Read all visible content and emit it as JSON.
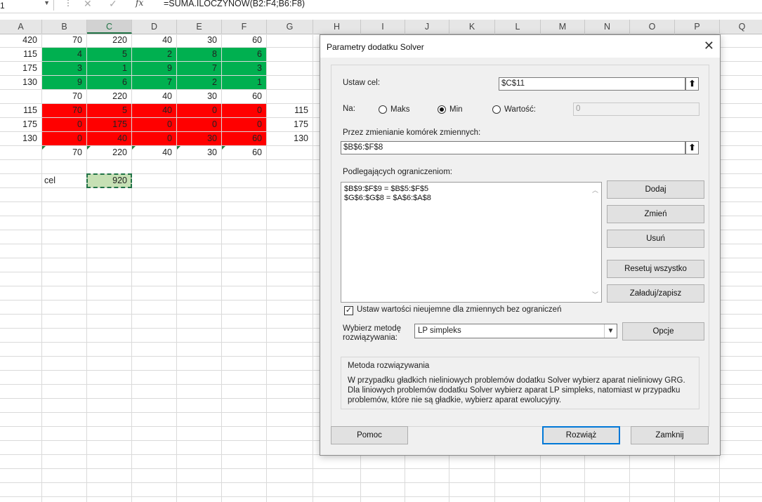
{
  "formula_bar": {
    "name_box": "1",
    "cancel_icon": "✕",
    "enter_icon": "✓",
    "fx_label": "fx",
    "formula": "=SUMA.ILOCZYNOW(B2:F4;B6:F8)"
  },
  "columns": [
    "A",
    "B",
    "C",
    "D",
    "E",
    "F",
    "G",
    "H",
    "I",
    "J",
    "K",
    "L",
    "M",
    "N",
    "O",
    "P",
    "Q"
  ],
  "selected_column": "C",
  "sheet": {
    "row1": [
      "420",
      "70",
      "220",
      "40",
      "30",
      "60"
    ],
    "green_rows": [
      [
        "115",
        "4",
        "5",
        "2",
        "8",
        "6"
      ],
      [
        "175",
        "3",
        "1",
        "9",
        "7",
        "3"
      ],
      [
        "130",
        "9",
        "6",
        "7",
        "2",
        "1"
      ]
    ],
    "row5": [
      "70",
      "220",
      "40",
      "30",
      "60"
    ],
    "red_rows": [
      [
        "115",
        "70",
        "5",
        "40",
        "0",
        "0",
        "115"
      ],
      [
        "175",
        "0",
        "175",
        "0",
        "0",
        "0",
        "175"
      ],
      [
        "130",
        "0",
        "40",
        "0",
        "30",
        "60",
        "130"
      ]
    ],
    "row9": [
      "70",
      "220",
      "40",
      "30",
      "60"
    ],
    "target_label": "cel",
    "target_value": "920"
  },
  "colors": {
    "green_fill": "#00b050",
    "red_fill": "#ff0000",
    "selected_fill": "#c6e0b4",
    "accent": "#217346",
    "default_button_border": "#0078d7"
  },
  "dialog": {
    "title": "Parametry dodatku Solver",
    "close_icon": "✕",
    "objective_label": "Ustaw cel:",
    "objective_value": "$C$11",
    "to_label": "Na:",
    "options": [
      "Maks",
      "Min",
      "Wartość:"
    ],
    "selected_option": "Min",
    "value_of": "0",
    "changing_label": "Przez zmienianie komórek zmiennych:",
    "changing_value": "$B$6:$F$8",
    "ref_icon": "⬆",
    "constraints_label": "Podlegających ograniczeniom:",
    "constraints": [
      "$B$9:$F$9 = $B$5:$F$5",
      "$G$6:$G$8 = $A$6:$A$8"
    ],
    "buttons": {
      "add": "Dodaj",
      "change": "Zmień",
      "delete": "Usuń",
      "reset": "Resetuj wszystko",
      "load_save": "Załaduj/zapisz",
      "options": "Opcje",
      "help": "Pomoc",
      "solve": "Rozwiąż",
      "close": "Zamknij"
    },
    "nonneg_label": "Ustaw wartości nieujemne dla zmiennych bez ograniczeń",
    "nonneg_checked": true,
    "check_mark": "✓",
    "method_label_1": "Wybierz metodę",
    "method_label_2": "rozwiązywania:",
    "method_value": "LP simpleks",
    "desc_title": "Metoda rozwiązywania",
    "desc_text": "W przypadku gładkich nieliniowych problemów dodatku Solver wybierz aparat nieliniowy GRG. Dla liniowych problemów dodatku Solver wybierz aparat LP simpleks, natomiast w przypadku problemów, które nie są gładkie, wybierz aparat ewolucyjny."
  }
}
